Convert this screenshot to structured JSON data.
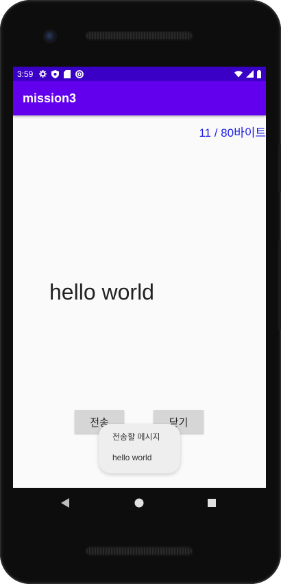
{
  "status_bar": {
    "time": "3:59",
    "icons": [
      "settings-icon",
      "shield-icon",
      "sd-card-icon",
      "at-sign-icon",
      "wifi-icon",
      "signal-icon",
      "battery-icon"
    ]
  },
  "app_bar": {
    "title": "mission3",
    "color": "#6200ee",
    "status_color": "#3a00c5"
  },
  "main": {
    "byte_counter": "11 / 80바이트",
    "message_text": "hello world",
    "send_button": "전송",
    "close_button": "닫기"
  },
  "toast": {
    "title": "전송할 메시지",
    "message": "hello world"
  },
  "nav_bar": {
    "buttons": [
      "back-icon",
      "home-icon",
      "recents-icon"
    ]
  }
}
